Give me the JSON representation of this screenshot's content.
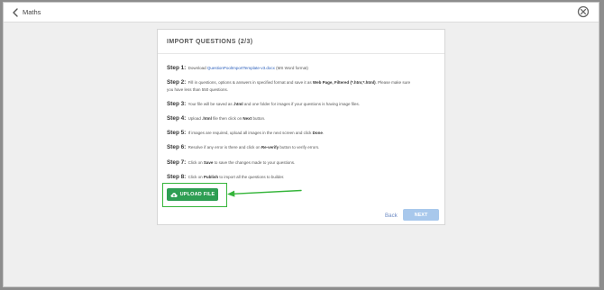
{
  "header": {
    "title": "Maths",
    "back_icon": "chevron-left-icon",
    "close_icon": "close-circle-icon"
  },
  "modal": {
    "title": "IMPORT QUESTIONS (2/3)",
    "steps": [
      {
        "label": "Step 1:",
        "pre": "Download",
        "link": "QuestionPoolImportTemplate-v3.docx",
        "post": "(MS Word format)"
      },
      {
        "label": "Step 2:",
        "line1_pre": "Fill in questions, options & answers in specified format and save it as",
        "bold1": "Web Page, Filtered (*.htm;*.html)",
        "line1_post": ". Please make sure",
        "line2": "you have less than 550 questions."
      },
      {
        "label": "Step 3:",
        "pre": "Your file will be saved as",
        "bold1": ".html",
        "post": "and one folder for images if your questions is having image files."
      },
      {
        "label": "Step 4:",
        "pre": "Upload",
        "bold1": ".html",
        "mid": "file then click on",
        "bold2": "Next",
        "post": "button."
      },
      {
        "label": "Step 5:",
        "pre": "If images are required, upload all images in the next screen and click",
        "bold1": "Done",
        "post": "."
      },
      {
        "label": "Step 6:",
        "pre": "Resolve if any error is there and click on",
        "bold1": "Re-verify",
        "post": "button to verify errors."
      },
      {
        "label": "Step 7:",
        "pre": "Click on",
        "bold1": "Save",
        "post": "to save the changes made to your questions."
      },
      {
        "label": "Step 8:",
        "pre": "Click on",
        "bold1": "Publish",
        "post": "to import all the questions to builder."
      }
    ],
    "upload_button": {
      "label": "UPLOAD FILE",
      "icon": "cloud-upload-icon"
    },
    "back_label": "Back",
    "next_label": "NEXT"
  },
  "colors": {
    "upload_green": "#2e9e53",
    "highlight_green": "#35b53a",
    "link_blue": "#2b5fbb",
    "next_disabled": "#a8c8ec"
  }
}
